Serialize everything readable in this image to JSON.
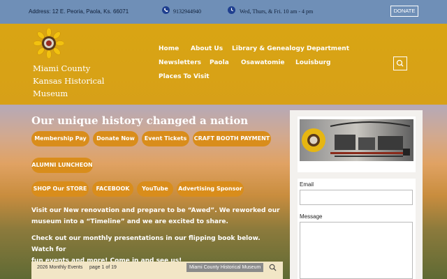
{
  "topbar": {
    "address": "Address: 12 E. Peoria, Paola, Ks. 66071",
    "phone": "9132944940",
    "hours": "Wed, Thurs, & Fri. 10 am - 4 pm",
    "donate_label": "DONATE"
  },
  "site": {
    "name_line1": "Miami County",
    "name_line2": "Kansas Historical",
    "name_line3": "Museum"
  },
  "nav": {
    "items": [
      "Home",
      "About Us",
      "Library & Genealogy Department",
      "Newsletters",
      "Paola",
      "Osawatomie",
      "Louisburg",
      "Places To Visit"
    ]
  },
  "hero": {
    "title": "Our unique history changed a nation",
    "buttons": [
      "Membership Pay",
      "Donate Now",
      "Event Tickets",
      "CRAFT BOOTH PAYMENT",
      "ALUMNI LUNCHEON",
      "SHOP Our STORE",
      "FACEBOOK",
      "YouTube",
      "Advertising Sponsor"
    ],
    "para1_line1": "Visit our New renovation and prepare to be “Awed”. We reworked our",
    "para1_line2": "museum into a “Timeline” and we are excited to share.",
    "para2_line1": "Check out our monthly presentations in our flipping book below. Watch for",
    "para2_line2": "fun events and more! Come in and see us!"
  },
  "flipbook": {
    "title": "2026 Monthly Events",
    "pages": "page 1 of 19",
    "tag": "Miami County Historical Museum"
  },
  "sidebar": {
    "email_label": "Email",
    "message_label": "Message"
  },
  "colors": {
    "topbar": "#6f8fb7",
    "header": "#d9a513",
    "button": "#d98d1b"
  },
  "icons": {
    "phone": "phone-icon",
    "clock": "clock-icon",
    "search": "search-icon",
    "logo": "sunflower-logo-icon"
  }
}
